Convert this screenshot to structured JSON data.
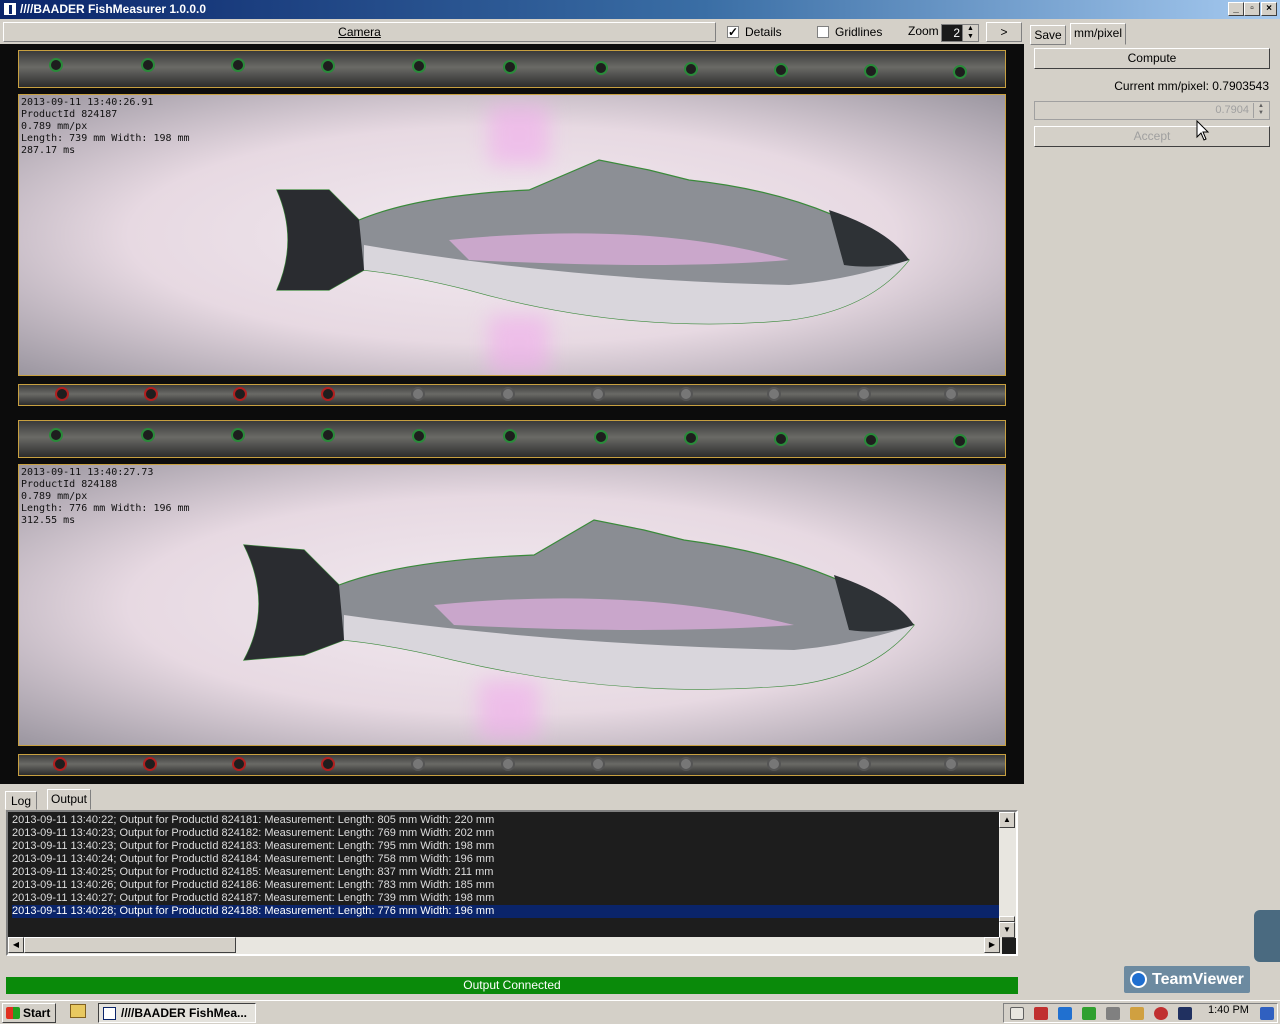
{
  "window": {
    "title": "////BAADER FishMeasurer 1.0.0.0"
  },
  "toolbar": {
    "camera_label": "Camera",
    "details_label": "Details",
    "details_checked": true,
    "gridlines_label": "Gridlines",
    "gridlines_checked": false,
    "zoom_label": "Zoom",
    "zoom_value": "2",
    "next_label": ">"
  },
  "camera_view": {
    "frames": [
      {
        "line1": "2013-09-11 13:40:26.91",
        "line2": "ProductId 824187",
        "line3": "0.789 mm/px",
        "line4": "Length: 739 mm Width: 198 mm",
        "line5": "287.17 ms"
      },
      {
        "line1": "2013-09-11 13:40:27.73",
        "line2": "ProductId 824188",
        "line3": "0.789 mm/px",
        "line4": "Length: 776 mm Width: 196 mm",
        "line5": "312.55 ms"
      }
    ]
  },
  "sidebar": {
    "tabs": [
      "Save",
      "mm/pixel"
    ],
    "compute_label": "Compute",
    "current_label": "Current mm/pixel: 0.7903543",
    "spin_value": "0.7904",
    "accept_label": "Accept"
  },
  "log": {
    "tabs": [
      "Log",
      "Output"
    ],
    "lines": [
      "2013-09-11 13:40:22; Output for ProductId 824181: Measurement: Length: 805 mm Width: 220 mm",
      "2013-09-11 13:40:23; Output for ProductId 824182: Measurement: Length: 769 mm Width: 202 mm",
      "2013-09-11 13:40:23; Output for ProductId 824183: Measurement: Length: 795 mm Width: 198 mm",
      "2013-09-11 13:40:24; Output for ProductId 824184: Measurement: Length: 758 mm Width: 196 mm",
      "2013-09-11 13:40:25; Output for ProductId 824185: Measurement: Length: 837 mm Width: 211 mm",
      "2013-09-11 13:40:26; Output for ProductId 824186: Measurement: Length: 783 mm Width: 185 mm",
      "2013-09-11 13:40:27; Output for ProductId 824187: Measurement: Length: 739 mm Width: 198 mm",
      "2013-09-11 13:40:28; Output for ProductId 824188: Measurement: Length: 776 mm Width: 196 mm"
    ],
    "selected_index": 7
  },
  "status": {
    "text": "Output Connected",
    "color": "#0a8a0a"
  },
  "teamviewer": {
    "label": "TeamViewer"
  },
  "taskbar": {
    "start_label": "Start",
    "task_label": "////BAADER FishMea...",
    "clock": "1:40 PM"
  }
}
